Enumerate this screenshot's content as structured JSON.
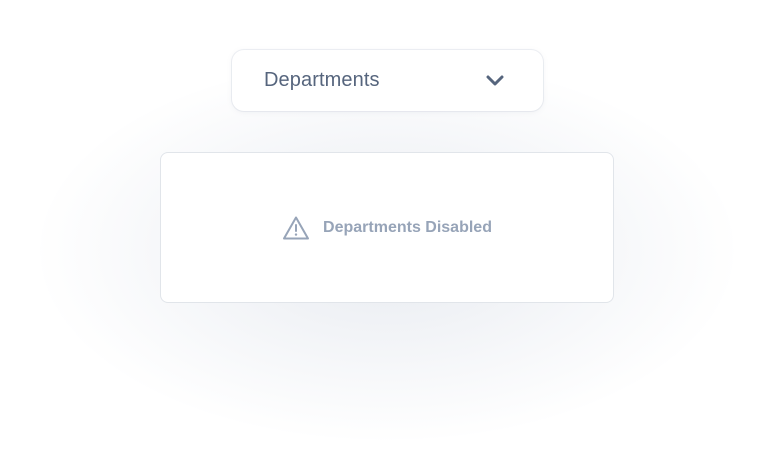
{
  "dropdown": {
    "label": "Departments",
    "icon": "chevron-down-icon"
  },
  "panel": {
    "message": "Departments Disabled",
    "icon": "warning-triangle-icon"
  },
  "colors": {
    "dropdown_text": "#56657d",
    "notice_text": "#97a4b8",
    "panel_border": "#e1e5ea"
  }
}
